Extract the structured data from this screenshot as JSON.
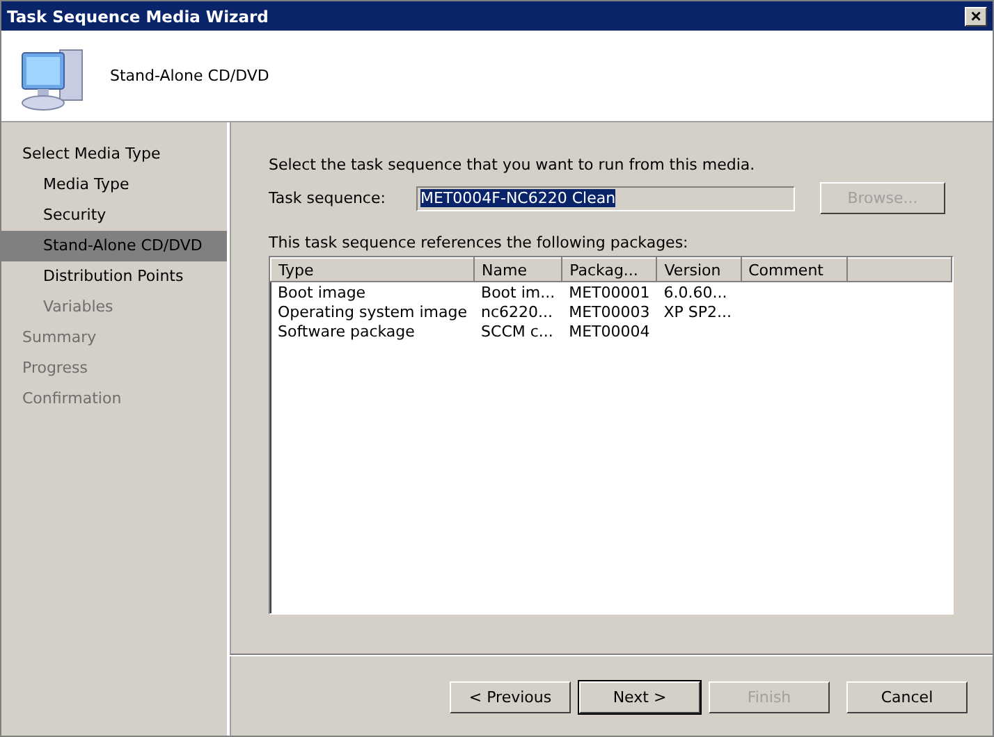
{
  "window": {
    "title": "Task Sequence Media Wizard",
    "close": "×"
  },
  "header": {
    "title": "Stand-Alone CD/DVD"
  },
  "sidebar": {
    "items": [
      {
        "label": "Select Media Type",
        "selected": false,
        "disabled": false,
        "children": [
          {
            "label": "Media Type",
            "selected": false,
            "disabled": false
          },
          {
            "label": "Security",
            "selected": false,
            "disabled": false
          },
          {
            "label": "Stand-Alone CD/DVD",
            "selected": true,
            "disabled": false
          },
          {
            "label": "Distribution Points",
            "selected": false,
            "disabled": false
          },
          {
            "label": "Variables",
            "selected": false,
            "disabled": true
          }
        ]
      },
      {
        "label": "Summary",
        "selected": false,
        "disabled": true
      },
      {
        "label": "Progress",
        "selected": false,
        "disabled": true
      },
      {
        "label": "Confirmation",
        "selected": false,
        "disabled": true
      }
    ]
  },
  "content": {
    "instruction": "Select the task sequence that you want to run from this media.",
    "task_sequence": {
      "label": "Task sequence:",
      "value": "MET0004F-NC6220 Clean",
      "browse": {
        "label": "Browse...",
        "disabled": true
      }
    },
    "packages_label": "This task sequence references the following packages:",
    "table": {
      "columns": [
        "Type",
        "Name",
        "Packag...",
        "Version",
        "Comment"
      ],
      "rows": [
        [
          "Boot image",
          "Boot im...",
          "MET00001",
          "6.0.60...",
          ""
        ],
        [
          "Operating system image",
          "nc6220...",
          "MET00003",
          "XP SP2...",
          ""
        ],
        [
          "Software package",
          "SCCM c...",
          "MET00004",
          "",
          ""
        ]
      ]
    }
  },
  "buttons": [
    {
      "label": "< Previous",
      "disabled": false,
      "default": false
    },
    {
      "label": "Next >",
      "disabled": false,
      "default": true
    },
    {
      "label": "Finish",
      "disabled": true,
      "default": false
    },
    {
      "label": "Cancel",
      "disabled": false,
      "default": false
    }
  ]
}
